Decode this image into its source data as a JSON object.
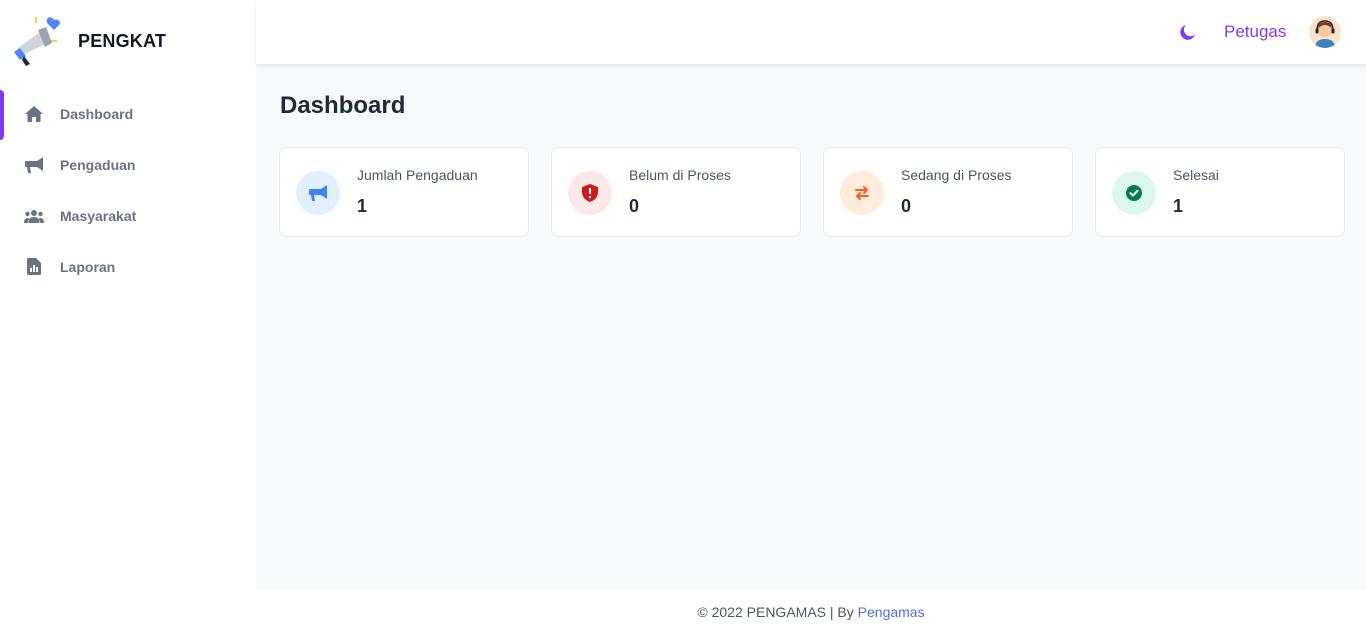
{
  "brand": {
    "name": "PENGKAT"
  },
  "sidebar": {
    "items": [
      {
        "label": "Dashboard",
        "icon": "home-icon",
        "active": true
      },
      {
        "label": "Pengaduan",
        "icon": "megaphone-icon",
        "active": false
      },
      {
        "label": "Masyarakat",
        "icon": "users-icon",
        "active": false
      },
      {
        "label": "Laporan",
        "icon": "report-file-icon",
        "active": false
      }
    ]
  },
  "header": {
    "theme_icon": "moon-icon",
    "user_name": "Petugas",
    "avatar_icon": "avatar-icon"
  },
  "main": {
    "title": "Dashboard",
    "cards": [
      {
        "label": "Jumlah Pengaduan",
        "value": "1",
        "icon": "megaphone-icon",
        "color": "#3f83f8",
        "bg": "#e1effe"
      },
      {
        "label": "Belum di Proses",
        "value": "0",
        "icon": "shield-alert-icon",
        "color": "#c81e1e",
        "bg": "#fde8e8"
      },
      {
        "label": "Sedang di Proses",
        "value": "0",
        "icon": "swap-arrows-icon",
        "color": "#ff5a1f",
        "bg": "#feecdc"
      },
      {
        "label": "Selesai",
        "value": "1",
        "icon": "check-circle-icon",
        "color": "#057a55",
        "bg": "#def7ec"
      }
    ]
  },
  "footer": {
    "text": "© 2022 PENGAMAS",
    "separator": "|",
    "by": "By",
    "link": "Pengamas"
  },
  "colors": {
    "accent": "#7e3af2",
    "link": "#4f6fd9"
  }
}
